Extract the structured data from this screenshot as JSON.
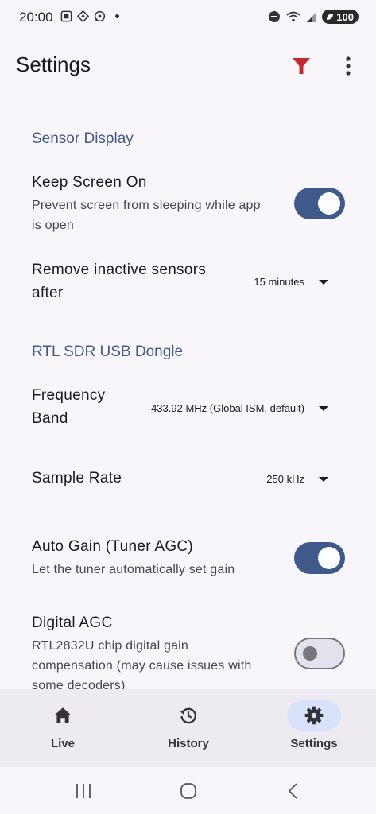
{
  "status_bar": {
    "time": "20:00",
    "battery": "100"
  },
  "app_bar": {
    "title": "Settings",
    "filter_icon": "filter-icon",
    "more_icon": "more-vert-icon"
  },
  "sections": {
    "sensor_display": {
      "header": "Sensor Display",
      "keep_screen_on": {
        "title": "Keep Screen On",
        "summary_line1": "Prevent screen from sleeping while app",
        "summary_line2": "is open",
        "enabled": true
      },
      "remove_inactive": {
        "title_line1": "Remove inactive sensors",
        "title_line2": "after",
        "value": "15 minutes"
      }
    },
    "rtl_sdr": {
      "header": "RTL SDR USB Dongle",
      "frequency_band": {
        "title_line1": "Frequency",
        "title_line2": "Band",
        "value": "433.92 MHz (Global ISM, default)"
      },
      "sample_rate": {
        "title": "Sample Rate",
        "value": "250 kHz"
      },
      "auto_gain": {
        "title": "Auto Gain (Tuner AGC)",
        "summary": "Let the tuner automatically set gain",
        "enabled": true
      },
      "digital_agc": {
        "title": "Digital AGC",
        "summary_line1": "RTL2832U chip digital gain",
        "summary_line2": "compensation (may cause issues with",
        "summary_line3": "some decoders)",
        "enabled": false
      }
    }
  },
  "bottom_nav": {
    "items": [
      {
        "label": "Live",
        "icon": "home-icon",
        "selected": false
      },
      {
        "label": "History",
        "icon": "history-icon",
        "selected": false
      },
      {
        "label": "Settings",
        "icon": "gear-icon",
        "selected": true
      }
    ]
  },
  "colors": {
    "accent": "#3f5a8a",
    "filter": "#c62828",
    "background": "#f8f6fb",
    "nav_background": "#edeaf1",
    "nav_indicator": "#d9e2fb"
  }
}
